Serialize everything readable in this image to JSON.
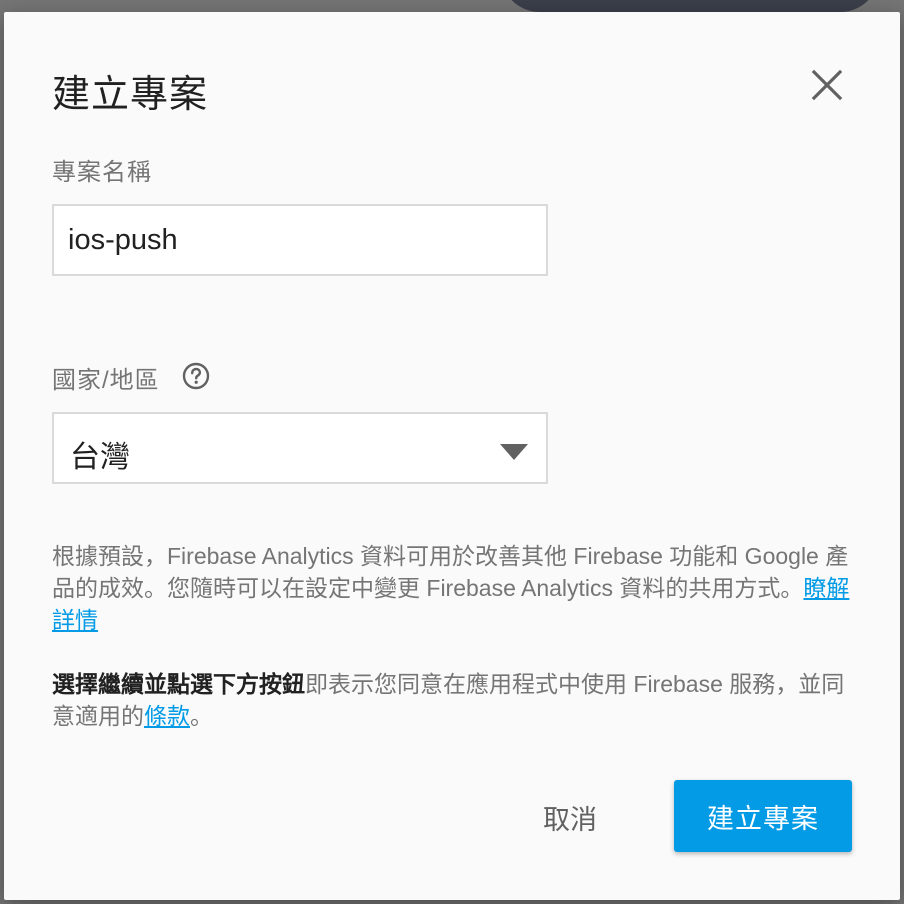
{
  "dialog": {
    "title": "建立專案",
    "close_icon": "close-icon"
  },
  "project_name": {
    "label": "專案名稱",
    "value": "ios-push"
  },
  "country": {
    "label": "國家/地區",
    "help_icon": "help-circle-icon",
    "selected": "台灣",
    "dropdown_icon": "triangle-down-icon"
  },
  "analytics_notice": {
    "text": "根據預設，Firebase Analytics 資料可用於改善其他 Firebase 功能和 Google 產品的成效。您隨時可以在設定中變更 Firebase Analytics 資料的共用方式。",
    "link": "瞭解詳情"
  },
  "terms_notice": {
    "bold": "選擇繼續並點選下方按鈕",
    "text": "即表示您同意在應用程式中使用 Firebase 服務，並同意適用的",
    "link": "條款",
    "end": "。"
  },
  "actions": {
    "cancel_label": "取消",
    "create_label": "建立專案"
  },
  "colors": {
    "accent": "#039be5",
    "dialog_bg": "#fafafa",
    "muted_text": "#757575"
  }
}
